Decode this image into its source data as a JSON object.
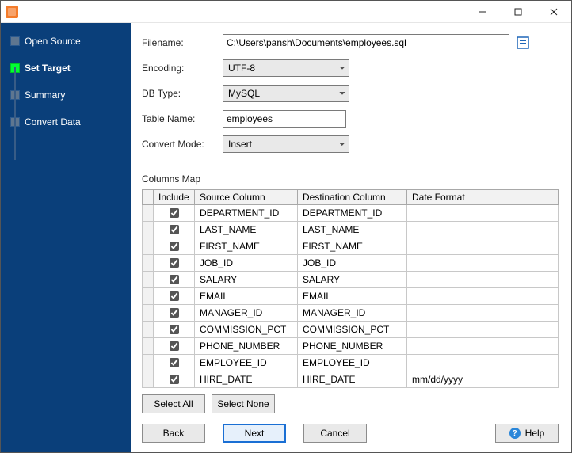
{
  "sidebar": {
    "steps": [
      {
        "label": "Open Source",
        "active": false
      },
      {
        "label": "Set Target",
        "active": true
      },
      {
        "label": "Summary",
        "active": false
      },
      {
        "label": "Convert Data",
        "active": false
      }
    ]
  },
  "form": {
    "filename_label": "Filename:",
    "filename_value": "C:\\Users\\pansh\\Documents\\employees.sql",
    "encoding_label": "Encoding:",
    "encoding_value": "UTF-8",
    "dbtype_label": "DB Type:",
    "dbtype_value": "MySQL",
    "table_label": "Table Name:",
    "table_value": "employees",
    "mode_label": "Convert Mode:",
    "mode_value": "Insert"
  },
  "columns_map": {
    "title": "Columns Map",
    "headers": {
      "include": "Include",
      "source": "Source Column",
      "dest": "Destination Column",
      "datefmt": "Date Format"
    },
    "rows": [
      {
        "include": true,
        "source": "DEPARTMENT_ID",
        "dest": "DEPARTMENT_ID",
        "datefmt": ""
      },
      {
        "include": true,
        "source": "LAST_NAME",
        "dest": "LAST_NAME",
        "datefmt": ""
      },
      {
        "include": true,
        "source": "FIRST_NAME",
        "dest": "FIRST_NAME",
        "datefmt": ""
      },
      {
        "include": true,
        "source": "JOB_ID",
        "dest": "JOB_ID",
        "datefmt": ""
      },
      {
        "include": true,
        "source": "SALARY",
        "dest": "SALARY",
        "datefmt": ""
      },
      {
        "include": true,
        "source": "EMAIL",
        "dest": "EMAIL",
        "datefmt": ""
      },
      {
        "include": true,
        "source": "MANAGER_ID",
        "dest": "MANAGER_ID",
        "datefmt": ""
      },
      {
        "include": true,
        "source": "COMMISSION_PCT",
        "dest": "COMMISSION_PCT",
        "datefmt": ""
      },
      {
        "include": true,
        "source": "PHONE_NUMBER",
        "dest": "PHONE_NUMBER",
        "datefmt": ""
      },
      {
        "include": true,
        "source": "EMPLOYEE_ID",
        "dest": "EMPLOYEE_ID",
        "datefmt": ""
      },
      {
        "include": true,
        "source": "HIRE_DATE",
        "dest": "HIRE_DATE",
        "datefmt": "mm/dd/yyyy"
      }
    ]
  },
  "buttons": {
    "select_all": "Select All",
    "select_none": "Select None",
    "back": "Back",
    "next": "Next",
    "cancel": "Cancel",
    "help": "Help"
  }
}
